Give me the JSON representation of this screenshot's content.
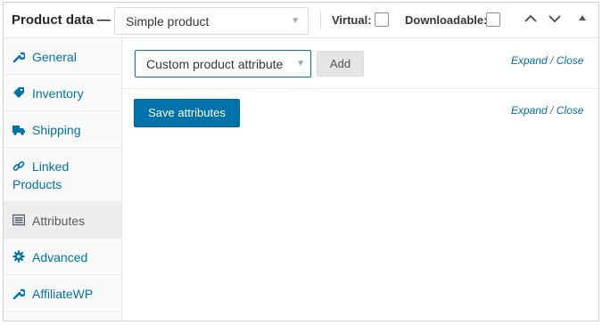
{
  "header": {
    "title": "Product data —",
    "product_type": "Simple product",
    "virtual_label": "Virtual:",
    "downloadable_label": "Downloadable:"
  },
  "sidebar": {
    "items": [
      {
        "label": "General",
        "icon": "wrench-icon"
      },
      {
        "label": "Inventory",
        "icon": "tag-icon"
      },
      {
        "label": "Shipping",
        "icon": "truck-icon"
      },
      {
        "label": "Linked",
        "label2": "Products",
        "icon": "link-icon"
      },
      {
        "label": "Attributes",
        "icon": "list-icon",
        "active": true
      },
      {
        "label": "Advanced",
        "icon": "gear-icon"
      },
      {
        "label": "AffiliateWP",
        "icon": "wrench-icon"
      }
    ]
  },
  "main": {
    "attribute_select": "Custom product attribute",
    "add_label": "Add",
    "expand_label": "Expand",
    "separator": "/",
    "close_label": "Close",
    "save_label": "Save attributes"
  },
  "colors": {
    "link": "#0073aa",
    "button_primary": "#0073aa",
    "active_tab_bg": "#eeeeee"
  }
}
